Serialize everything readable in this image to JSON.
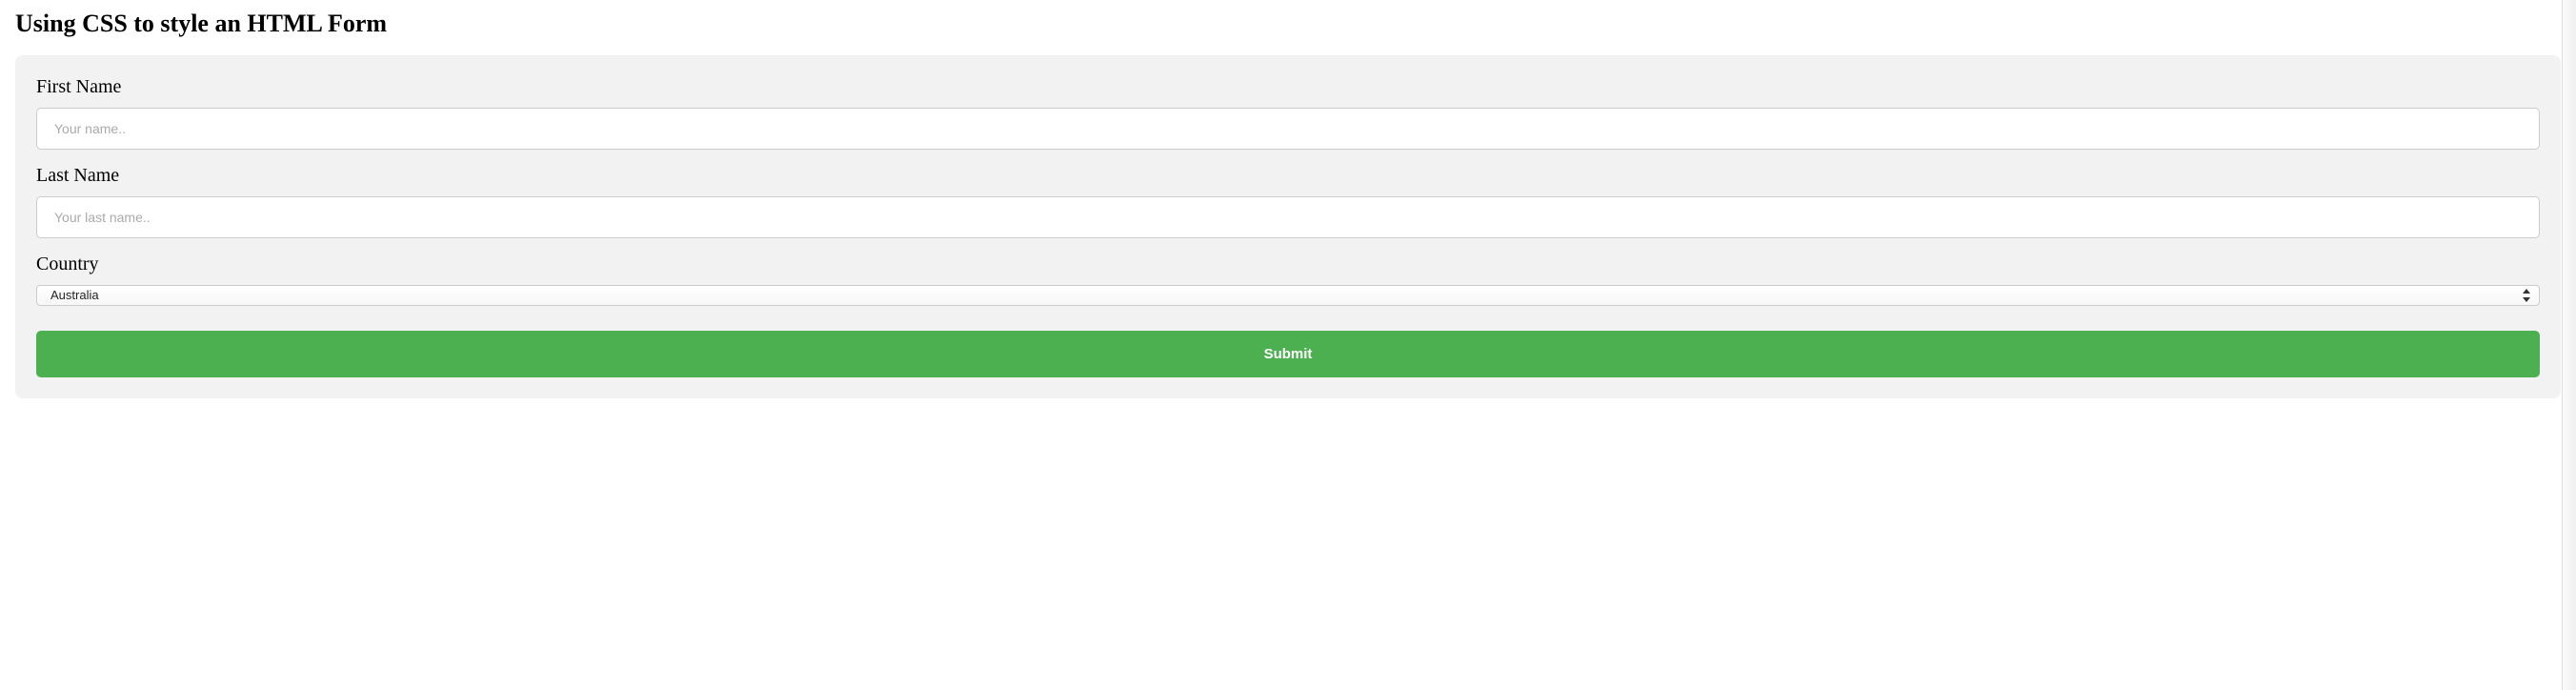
{
  "heading": "Using CSS to style an HTML Form",
  "form": {
    "first_name": {
      "label": "First Name",
      "placeholder": "Your name..",
      "value": ""
    },
    "last_name": {
      "label": "Last Name",
      "placeholder": "Your last name..",
      "value": ""
    },
    "country": {
      "label": "Country",
      "selected": "Australia"
    },
    "submit_label": "Submit"
  },
  "colors": {
    "card_bg": "#f2f2f2",
    "submit_bg": "#4CAF50",
    "input_border": "#cccccc"
  }
}
